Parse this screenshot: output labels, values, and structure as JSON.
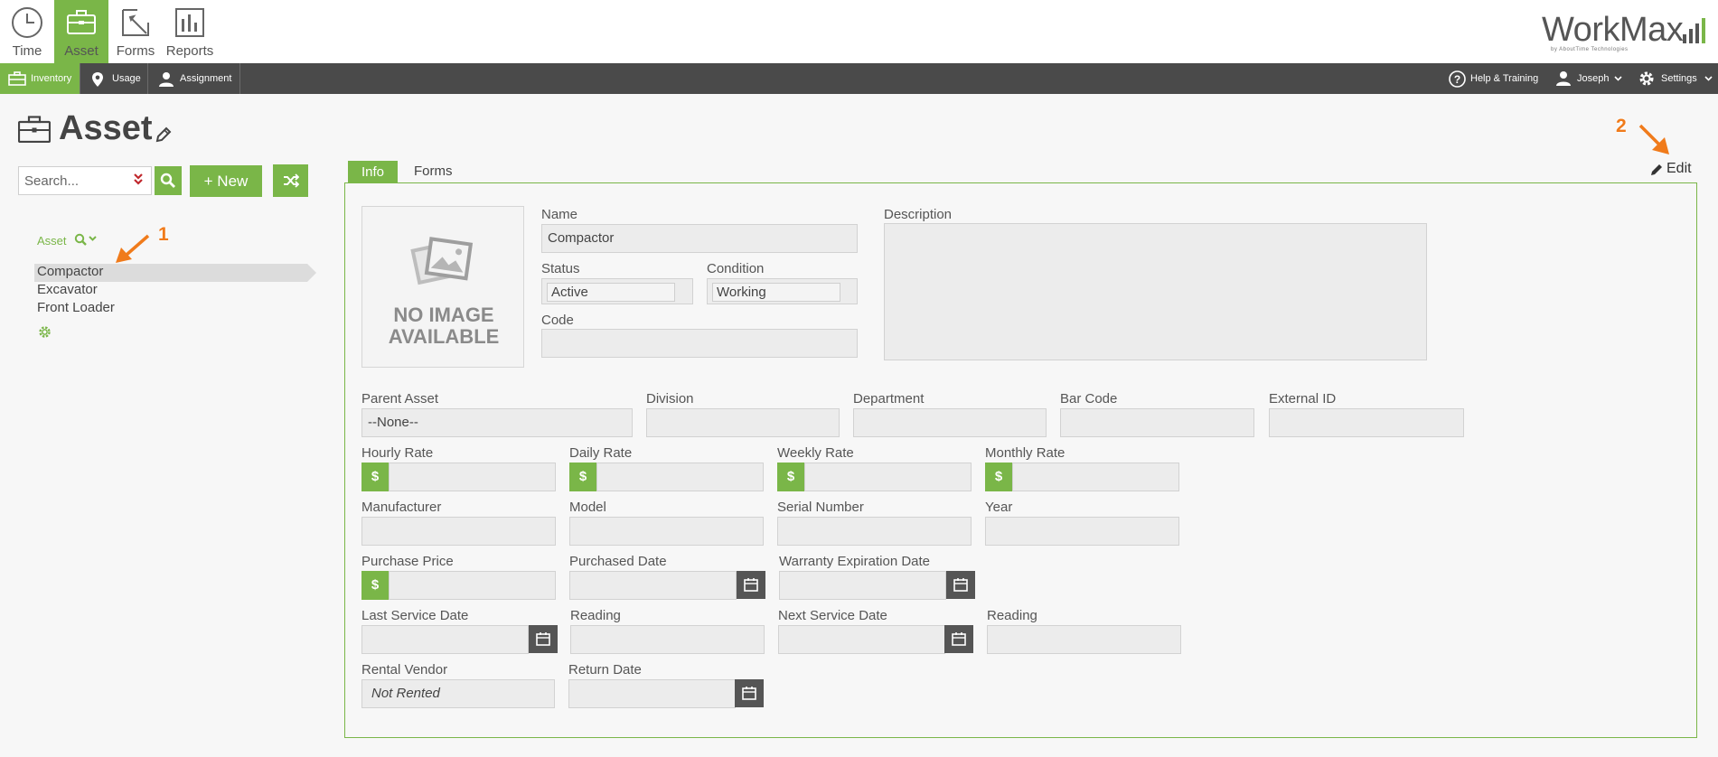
{
  "app_tabs": [
    {
      "label": "Time",
      "icon": "clock-icon"
    },
    {
      "label": "Asset",
      "icon": "briefcase-icon",
      "active": true
    },
    {
      "label": "Forms",
      "icon": "forms-icon"
    },
    {
      "label": "Reports",
      "icon": "reports-icon"
    }
  ],
  "logo": {
    "text": "WorkMax",
    "tagline": "by AboutTime Technologies"
  },
  "subnav": {
    "inventory": "Inventory",
    "usage": "Usage",
    "assignment": "Assignment",
    "help": "Help & Training",
    "user": "Joseph",
    "settings": "Settings"
  },
  "page": {
    "title": "Asset"
  },
  "search": {
    "placeholder": "Search...",
    "new_label": "+ New"
  },
  "tree": {
    "header": "Asset",
    "items": [
      "Compactor",
      "Excavator",
      "Front Loader"
    ],
    "selected": "Compactor"
  },
  "annotations": {
    "one": "1",
    "two": "2"
  },
  "tabs": {
    "info": "Info",
    "forms": "Forms",
    "edit": "Edit"
  },
  "no_image": {
    "line1": "NO IMAGE",
    "line2": "AVAILABLE"
  },
  "form": {
    "name_label": "Name",
    "name_value": "Compactor",
    "status_label": "Status",
    "status_value": "Active",
    "condition_label": "Condition",
    "condition_value": "Working",
    "code_label": "Code",
    "code_value": "",
    "description_label": "Description",
    "parent_asset_label": "Parent Asset",
    "parent_asset_value": "--None--",
    "division_label": "Division",
    "department_label": "Department",
    "bar_code_label": "Bar Code",
    "external_id_label": "External ID",
    "hourly_rate_label": "Hourly Rate",
    "daily_rate_label": "Daily Rate",
    "weekly_rate_label": "Weekly Rate",
    "monthly_rate_label": "Monthly Rate",
    "currency_symbol": "$",
    "manufacturer_label": "Manufacturer",
    "model_label": "Model",
    "serial_number_label": "Serial Number",
    "year_label": "Year",
    "purchase_price_label": "Purchase Price",
    "purchased_date_label": "Purchased Date",
    "warranty_label": "Warranty Expiration Date",
    "last_service_label": "Last Service Date",
    "reading_label": "Reading",
    "next_service_label": "Next Service Date",
    "reading2_label": "Reading",
    "rental_vendor_label": "Rental Vendor",
    "rental_vendor_value": "Not Rented",
    "return_date_label": "Return Date"
  },
  "colors": {
    "accent": "#7ab648",
    "subnav_bg": "#4a4a4a",
    "annotation": "#f07b1b"
  }
}
